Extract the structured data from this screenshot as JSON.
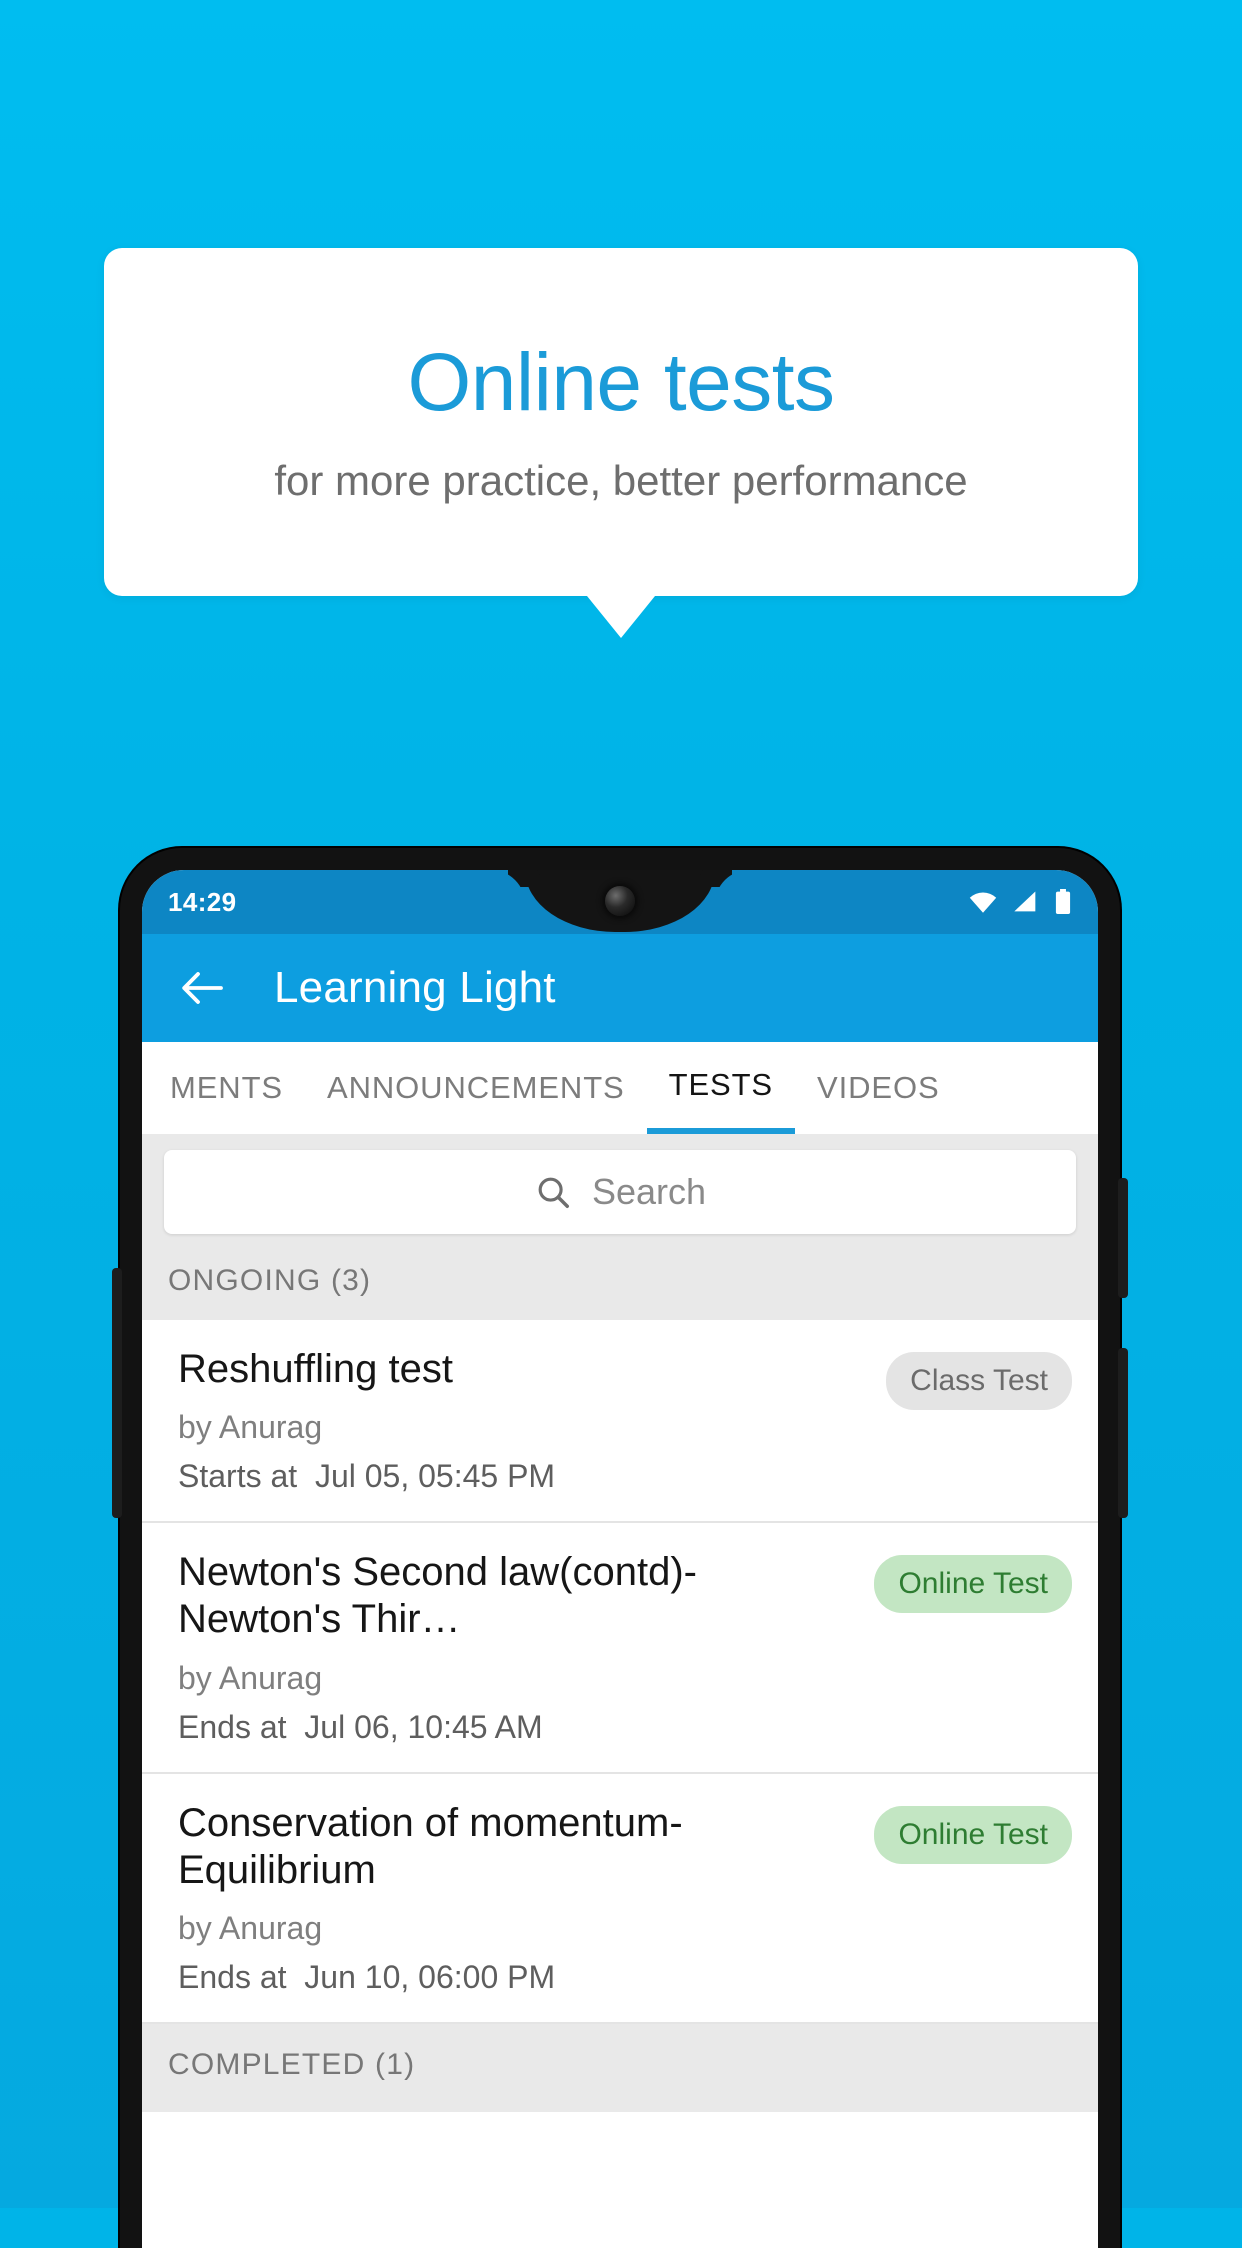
{
  "colors": {
    "brand_bg": "#00b4e8",
    "callout_title": "#1b9bd8",
    "appbar": "#0d9ee0",
    "statusbar": "#0d86c4",
    "badge_gray_bg": "#e4e4e4",
    "badge_green_bg": "#c3e6c3",
    "badge_green_text": "#2e7d32"
  },
  "callout": {
    "title": "Online tests",
    "subtitle": "for more practice, better performance"
  },
  "phone": {
    "status_bar": {
      "time": "14:29",
      "icons": [
        "wifi-icon",
        "signal-icon",
        "battery-icon"
      ]
    },
    "app_bar": {
      "back_icon": "back-arrow-icon",
      "title": "Learning Light"
    },
    "tabs": [
      {
        "label": "MENTS",
        "active": false
      },
      {
        "label": "ANNOUNCEMENTS",
        "active": false
      },
      {
        "label": "TESTS",
        "active": true
      },
      {
        "label": "VIDEOS",
        "active": false
      }
    ],
    "search": {
      "icon": "search-icon",
      "placeholder": "Search",
      "value": ""
    },
    "sections": [
      {
        "label": "ONGOING (3)"
      },
      {
        "label": "COMPLETED (1)"
      }
    ],
    "tests": [
      {
        "title": "Reshuffling test",
        "author": "by Anurag",
        "schedule_label": "Starts at",
        "schedule_value": "Jul 05, 05:45 PM",
        "badge": "Class Test",
        "badge_type": "gray"
      },
      {
        "title": "Newton's Second law(contd)-Newton's Thir…",
        "author": "by Anurag",
        "schedule_label": "Ends at",
        "schedule_value": "Jul 06, 10:45 AM",
        "badge": "Online Test",
        "badge_type": "green"
      },
      {
        "title": "Conservation of momentum-Equilibrium",
        "author": "by Anurag",
        "schedule_label": "Ends at",
        "schedule_value": "Jun 10, 06:00 PM",
        "badge": "Online Test",
        "badge_type": "green"
      }
    ]
  }
}
